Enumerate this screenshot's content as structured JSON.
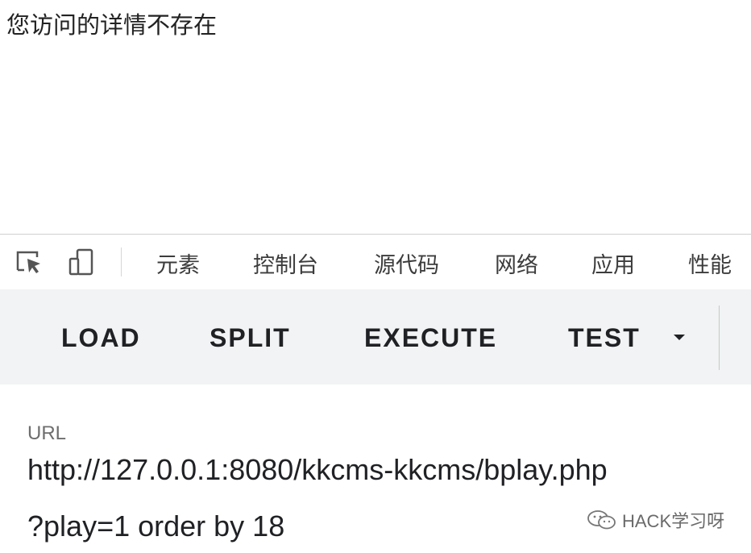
{
  "page": {
    "message": "您访问的详情不存在"
  },
  "devtools": {
    "icons": [
      "element-picker-icon",
      "device-toolbar-icon"
    ],
    "tabs": [
      "元素",
      "控制台",
      "源代码",
      "网络",
      "应用",
      "性能"
    ]
  },
  "hackbar": {
    "buttons": [
      "LOAD",
      "SPLIT",
      "EXECUTE",
      "TEST"
    ],
    "url_label": "URL",
    "url_lines": [
      "http://127.0.0.1:8080/kkcms-kkcms/bplay.php",
      "?play=1 order by 18"
    ]
  },
  "watermark": {
    "text": "HACK学习呀",
    "icon": "wechat-icon"
  }
}
